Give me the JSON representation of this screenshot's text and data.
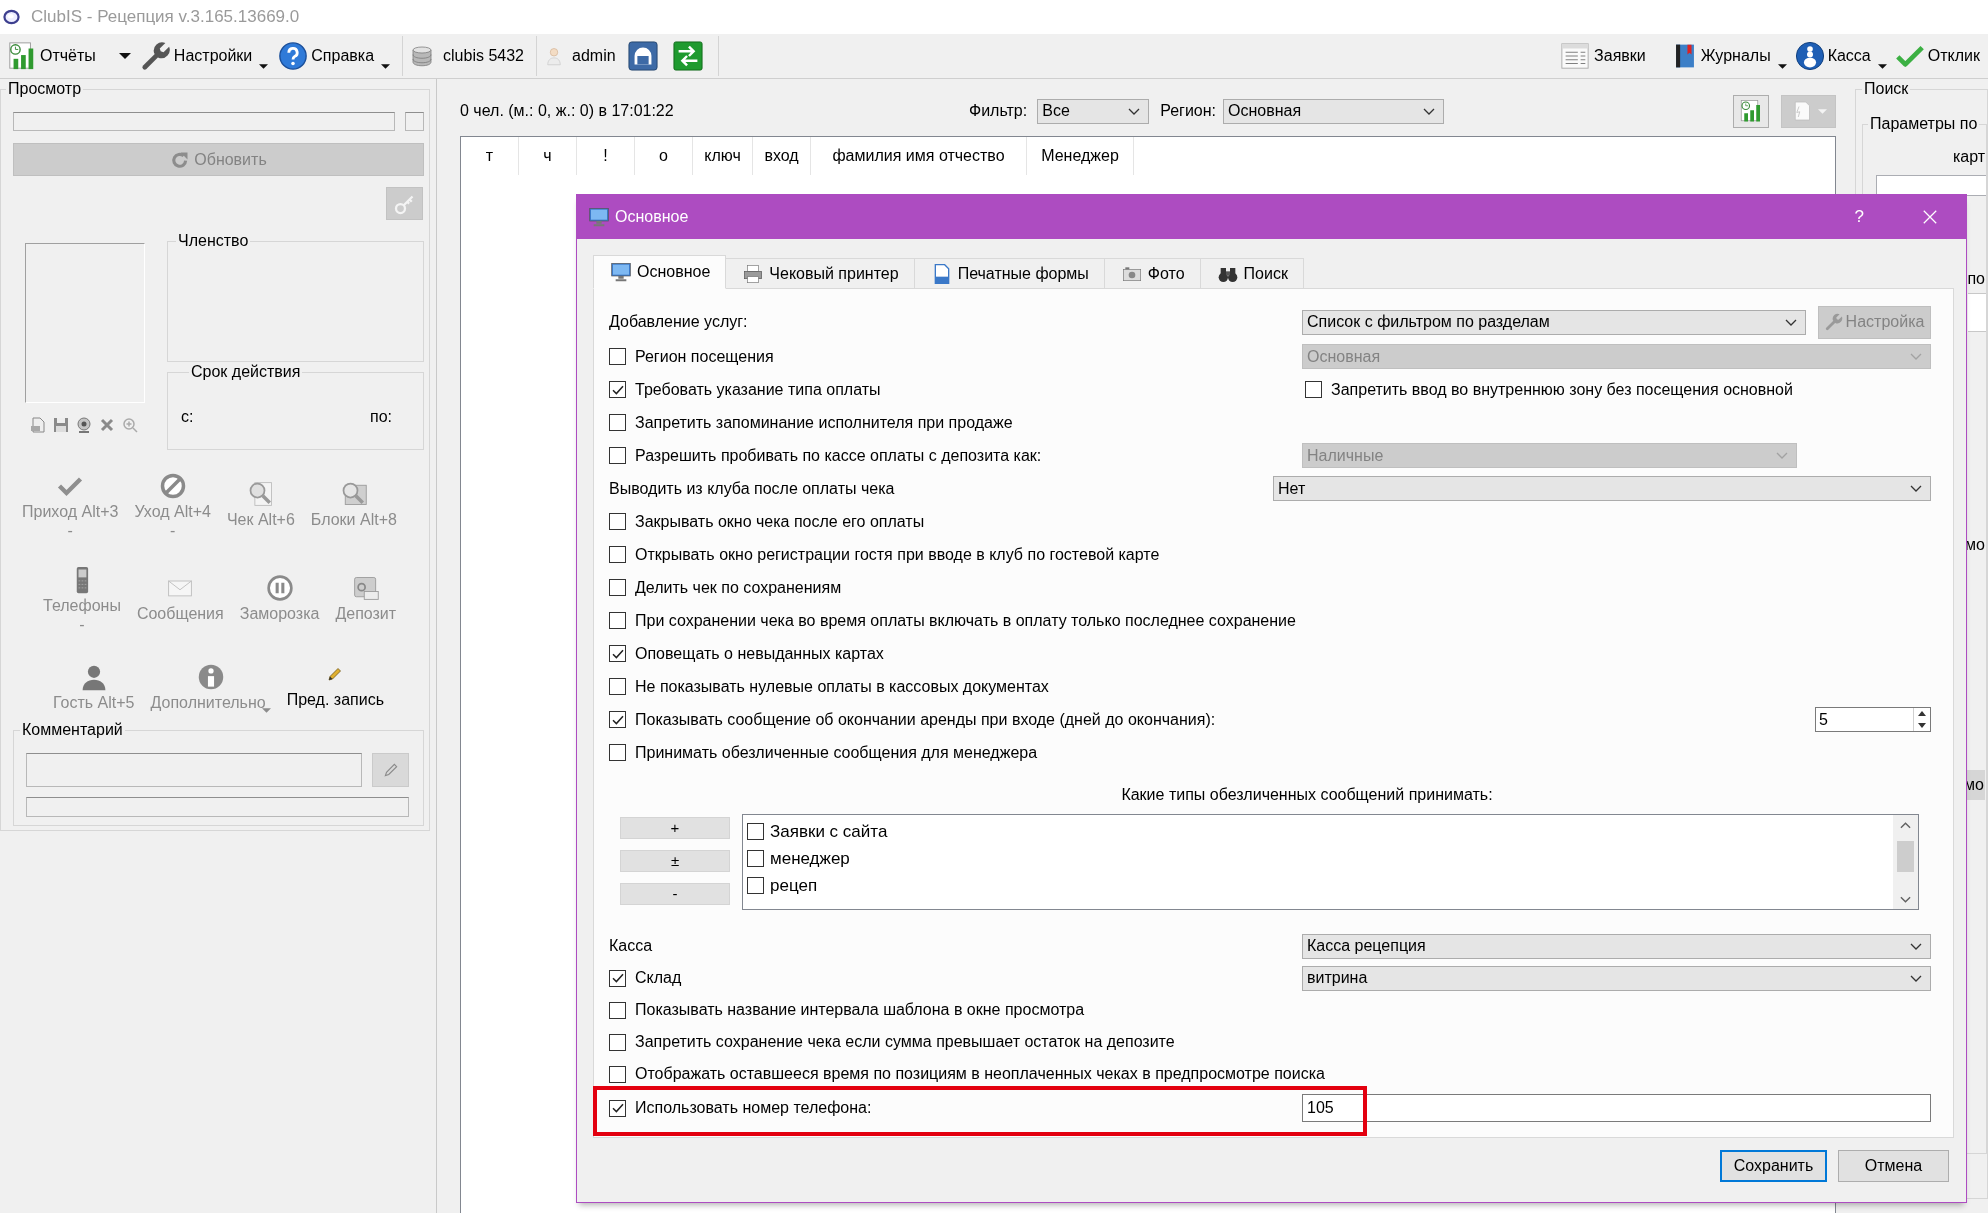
{
  "window": {
    "title": "ClubIS - Рецепция v.3.165.13669.0"
  },
  "toolbar": {
    "left": [
      {
        "label": "Отчёты",
        "dropdown": true
      },
      {
        "label": "Настройки",
        "dropdown": true
      },
      {
        "label": "Справка",
        "dropdown": true
      },
      {
        "label": "clubis 5432",
        "dropdown": false
      },
      {
        "label": "admin",
        "dropdown": false
      }
    ],
    "right": [
      {
        "label": "Заявки",
        "dropdown": false
      },
      {
        "label": "Журналы",
        "dropdown": true
      },
      {
        "label": "Касса",
        "dropdown": true
      },
      {
        "label": "Отклик",
        "dropdown": false
      }
    ]
  },
  "preview": {
    "title": "Просмотр",
    "refresh_button": {
      "label": "Обновить",
      "disabled": true
    },
    "key_button": {
      "disabled": true
    },
    "membership": {
      "title": "Членство"
    },
    "validity": {
      "title": "Срок действия",
      "from_label": "с:",
      "to_label": "по:"
    },
    "actions": [
      {
        "label": "Приход Alt+3",
        "note": "-",
        "disabled": true,
        "dropdown": false
      },
      {
        "label": "Уход Alt+4",
        "note": "-",
        "disabled": true,
        "dropdown": false
      },
      {
        "label": "Чек Alt+6",
        "disabled": true,
        "dropdown": false
      },
      {
        "label": "Блоки Alt+8",
        "disabled": true,
        "dropdown": false
      },
      {
        "label": "Телефоны",
        "note": "-",
        "disabled": true,
        "dropdown": false
      },
      {
        "label": "Сообщения",
        "disabled": true,
        "dropdown": false
      },
      {
        "label": "Заморозка",
        "disabled": true,
        "dropdown": false
      },
      {
        "label": "Депозит",
        "disabled": true,
        "dropdown": false
      },
      {
        "label": "Гость Alt+5",
        "disabled": true,
        "dropdown": false
      },
      {
        "label": "Дополнительно",
        "disabled": true,
        "dropdown": true
      },
      {
        "label": "Пред. запись",
        "disabled": false,
        "dropdown": false
      }
    ],
    "comment": {
      "title": "Комментарий",
      "edit_button": {
        "disabled": true
      }
    }
  },
  "visits": {
    "summary": "0 чел. (м.: 0, ж.: 0) в 17:01:22",
    "filter": {
      "label": "Фильтр:",
      "value": "Все"
    },
    "region": {
      "label": "Регион:",
      "value": "Основная"
    },
    "tool_buttons": [
      {
        "disabled": false,
        "dropdown": false
      },
      {
        "disabled": true,
        "dropdown": true
      }
    ],
    "table": {
      "columns": [
        "т",
        "ч",
        "!",
        "о",
        "ключ",
        "вход",
        "фамилия имя отчество",
        "Менеджер"
      ]
    }
  },
  "search_panel": {
    "title": "Поиск",
    "group_title": "Параметры по",
    "field_label": "карт",
    "labels": [
      "по",
      "мо"
    ],
    "button": "мо"
  },
  "dialog": {
    "title": "Основное",
    "help": "?",
    "tabs": [
      {
        "label": "Основное",
        "selected": true
      },
      {
        "label": "Чековый принтер",
        "selected": false
      },
      {
        "label": "Печатные формы",
        "selected": false
      },
      {
        "label": "Фото",
        "selected": false
      },
      {
        "label": "Поиск",
        "selected": false
      }
    ],
    "settings": [
      {
        "kind": "select",
        "label": "Добавление услуг:",
        "value": "Список с фильтром по разделам",
        "disabled": false,
        "button": {
          "label": "Настройка",
          "disabled": true
        }
      },
      {
        "kind": "checkbox-select",
        "label": "Регион посещения",
        "checked": false,
        "value": "Основная",
        "disabled": true
      },
      {
        "kind": "checkbox-pair",
        "label": "Требовать указание типа оплаты",
        "checked": true,
        "second": {
          "label": "Запретить ввод во внутреннюю зону без посещения основной",
          "checked": false
        }
      },
      {
        "kind": "checkbox",
        "label": "Запретить запоминание исполнителя при продаже",
        "checked": false
      },
      {
        "kind": "checkbox-select",
        "label": "Разрешить пробивать по кассе оплаты с депозита как:",
        "checked": false,
        "value": "Наличные",
        "disabled": true
      },
      {
        "kind": "select",
        "label": "Выводить из клуба после оплаты чека",
        "value": "Нет",
        "disabled": false
      },
      {
        "kind": "checkbox",
        "label": "Закрывать окно чека после его оплаты",
        "checked": false
      },
      {
        "kind": "checkbox",
        "label": "Открывать окно регистрации гостя при вводе в клуб по гостевой карте",
        "checked": false
      },
      {
        "kind": "checkbox",
        "label": "Делить чек по сохранениям",
        "checked": false
      },
      {
        "kind": "checkbox",
        "label": "При сохранении чека во время оплаты включать в оплату только последнее сохранение",
        "checked": false
      },
      {
        "kind": "checkbox",
        "label": "Оповещать о невыданных картах",
        "checked": true
      },
      {
        "kind": "checkbox",
        "label": "Не показывать нулевые оплаты в кассовых документах",
        "checked": false
      },
      {
        "kind": "checkbox-spin",
        "label": "Показывать сообщение об окончании аренды при входе (дней до окончания):",
        "checked": true,
        "value": "5"
      },
      {
        "kind": "checkbox",
        "label": "Принимать обезличенные сообщения для менеджера",
        "checked": false
      }
    ],
    "message_types": {
      "title": "Какие типы обезличенных сообщений принимать:",
      "buttons": [
        "+",
        "±",
        "-"
      ],
      "items": [
        {
          "label": "Заявки с сайта",
          "checked": false
        },
        {
          "label": "менеджер",
          "checked": false
        },
        {
          "label": "рецеп",
          "checked": false
        }
      ]
    },
    "more_settings": [
      {
        "kind": "select",
        "label": "Касса",
        "value": "Касса рецепция",
        "disabled": false
      },
      {
        "kind": "checkbox-select",
        "label": "Склад",
        "checked": true,
        "value": "витрина",
        "disabled": false
      },
      {
        "kind": "checkbox",
        "label": "Показывать название интервала шаблона в окне просмотра",
        "checked": false
      },
      {
        "kind": "checkbox",
        "label": "Запретить сохранение чека если сумма превышает остаток на депозите",
        "checked": false
      },
      {
        "kind": "checkbox",
        "label": "Отображать оставшееся время по позициям в неоплаченных чеках в предпросмотре поиска",
        "checked": false
      },
      {
        "kind": "checkbox-input",
        "label": "Использовать номер телефона:",
        "checked": true,
        "value": "105",
        "highlighted": true
      }
    ],
    "buttons": [
      {
        "label": "Сохранить",
        "default": true
      },
      {
        "label": "Отмена",
        "default": false
      }
    ]
  }
}
